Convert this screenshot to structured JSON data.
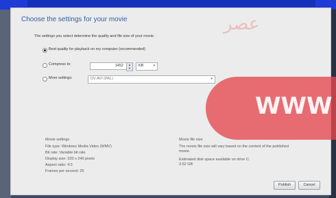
{
  "dialog": {
    "title": "Choose the settings for your movie",
    "subtitle": "The settings you select determine the quality and file size of your movie."
  },
  "options": {
    "best_quality_label": "Best quality for playback on my computer (recommended)",
    "compress_label": "Compress to:",
    "compress_value": "1452",
    "compress_unit": "KB",
    "more_settings_label": "More settings:",
    "more_settings_value": "DV-AVI (PAL)"
  },
  "movie_settings": {
    "title": "Movie settings",
    "lines": [
      "File type: Windows Media Video (WMV)",
      "Bit rate: Variable bit rate",
      "Display size: 320 x 240 pixels",
      "Aspect ratio: 4:3",
      "Frames per second: 25"
    ]
  },
  "estimate": {
    "title": "Movie file size",
    "text": "The movie file size will vary based on the content of the published movie.",
    "space_label": "Estimated disk space available on drive C:",
    "space_value": "3.62 GB"
  },
  "buttons": {
    "publish": "Publish",
    "cancel": "Cancel"
  },
  "watermark": {
    "arabic": "عصر",
    "latin": "WWW",
    "color": "#e6484e"
  }
}
